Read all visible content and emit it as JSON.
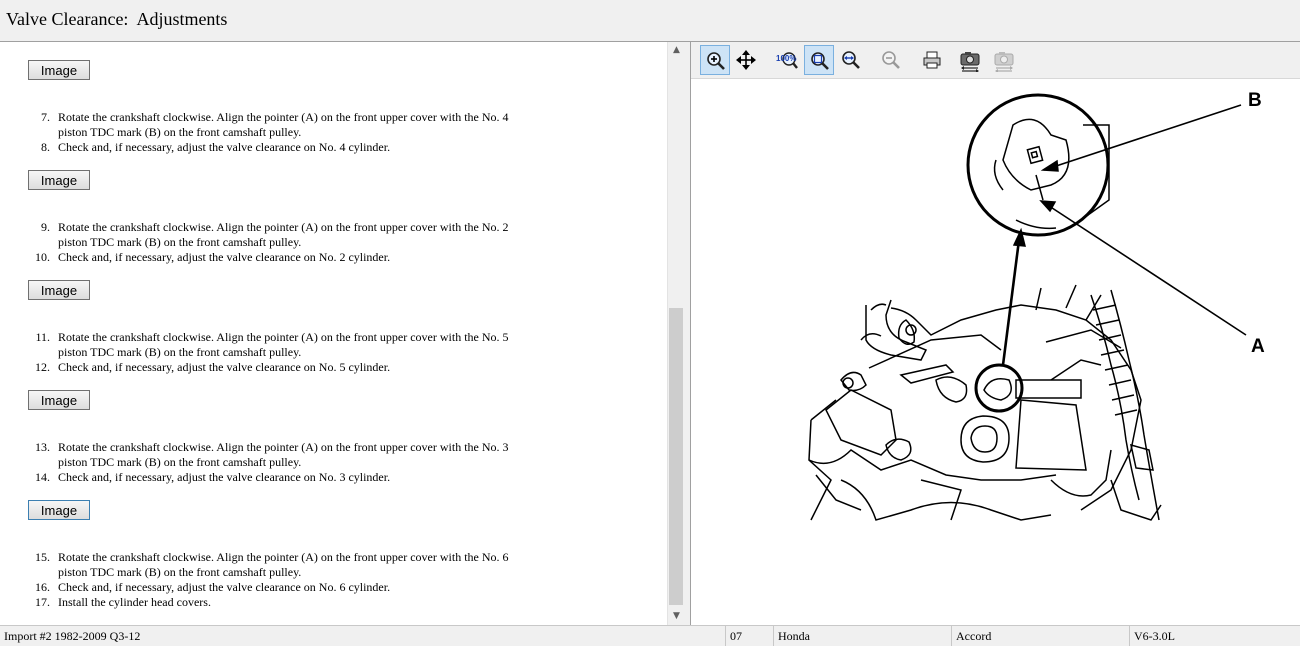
{
  "window": {
    "title": "Valve Clearance:  Adjustments"
  },
  "content": {
    "image_button_label": "Image",
    "steps": [
      {
        "num": "7.",
        "text": "Rotate the crankshaft clockwise. Align the pointer (A) on the front upper cover with the No. 4 piston TDC mark (B) on the front camshaft pulley."
      },
      {
        "num": "8.",
        "text": "Check and, if necessary, adjust the valve clearance on No. 4 cylinder."
      },
      {
        "num": "9.",
        "text": "Rotate the crankshaft clockwise. Align the pointer (A) on the front upper cover with the No. 2 piston TDC mark (B) on the front camshaft pulley."
      },
      {
        "num": "10.",
        "text": "Check and, if necessary, adjust the valve clearance on No. 2 cylinder."
      },
      {
        "num": "11.",
        "text": "Rotate the crankshaft clockwise. Align the pointer (A) on the front upper cover with the No. 5 piston TDC mark (B) on the front camshaft pulley."
      },
      {
        "num": "12.",
        "text": "Check and, if necessary, adjust the valve clearance on No. 5 cylinder."
      },
      {
        "num": "13.",
        "text": "Rotate the crankshaft clockwise. Align the pointer (A) on the front upper cover with the No. 3 piston TDC mark (B) on the front camshaft pulley."
      },
      {
        "num": "14.",
        "text": "Check and, if necessary, adjust the valve clearance on No. 3 cylinder."
      },
      {
        "num": "15.",
        "text": "Rotate the crankshaft clockwise. Align the pointer (A) on the front upper cover with the No. 6 piston TDC mark (B) on the front camshaft pulley."
      },
      {
        "num": "16.",
        "text": "Check and, if necessary, adjust the valve clearance on No. 6 cylinder."
      },
      {
        "num": "17.",
        "text": "Install the cylinder head covers."
      }
    ]
  },
  "toolbar": {
    "items": [
      {
        "name": "zoom-in-icon",
        "pressed": true
      },
      {
        "name": "pan-move-icon",
        "pressed": false
      },
      {
        "name": "actual-size-100-icon",
        "pressed": false,
        "label": "100%"
      },
      {
        "name": "fit-to-window-icon",
        "pressed": true
      },
      {
        "name": "fit-width-icon",
        "pressed": false
      },
      {
        "name": "zoom-out-icon",
        "pressed": false
      },
      {
        "name": "print-icon",
        "pressed": false
      },
      {
        "name": "copy-image-icon",
        "pressed": false
      },
      {
        "name": "copy-image-disabled-icon",
        "pressed": false
      }
    ]
  },
  "illustration": {
    "callout_a": "A",
    "callout_b": "B"
  },
  "statusbar": {
    "source": "Import #2 1982-2009 Q3-12",
    "code": "07",
    "make": "Honda",
    "model": "Accord",
    "engine": "V6-3.0L"
  },
  "colors": {
    "chrome": "#f0f0f0",
    "pressed": "#cde3f6",
    "accent_border": "#3c7fb1"
  }
}
